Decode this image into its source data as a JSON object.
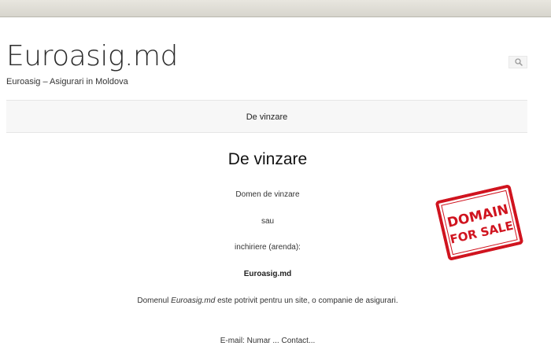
{
  "header": {
    "site_title": "Euroasig.md",
    "tagline": "Euroasig – Asigurari in Moldova",
    "search_icon": "search-icon"
  },
  "nav": {
    "items": [
      {
        "label": "De vinzare"
      }
    ]
  },
  "main": {
    "title": "De vinzare",
    "paragraphs": {
      "p1": "Domen de vinzare",
      "p2": "sau",
      "p3": "inchiriere (arenda):",
      "p4": "Euroasig.md",
      "p5_before": "Domenul ",
      "p5_em": "Euroasig.md",
      "p5_after": " este potrivit pentru un site, o companie de asigurari.",
      "p6_partial": "E-mail: Numar ... Contact..."
    }
  },
  "stamp": {
    "line1": "DOMAIN",
    "line2": "FOR SALE",
    "color": "#d0141f"
  },
  "colors": {
    "nav_background": "#f7f7f7",
    "browser_chrome": "#dcdad2"
  }
}
